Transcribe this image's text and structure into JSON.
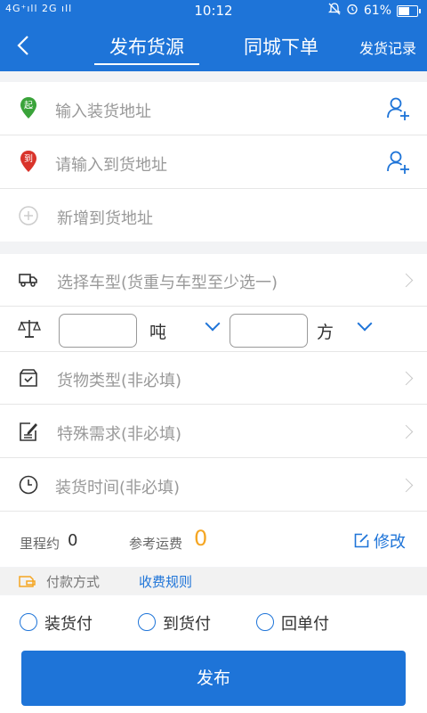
{
  "status": {
    "signal": "4G⁺ıll 2G ıll",
    "time": "10:12",
    "battery": "61%",
    "battery_level": 0.61
  },
  "nav": {
    "tab_publish": "发布货源",
    "tab_city": "同城下单",
    "records": "发货记录"
  },
  "address": {
    "load_placeholder": "输入装货地址",
    "load_badge": "起",
    "arrive_placeholder": "请输入到货地址",
    "arrive_badge": "到",
    "add_arrive": "新增到货地址"
  },
  "vehicle": {
    "select": "选择车型(货重与车型至少选一)"
  },
  "weight": {
    "unit_ton": "吨",
    "unit_cube": "方",
    "ton_value": "",
    "cube_value": ""
  },
  "goods": {
    "type": "货物类型(非必填)",
    "special": "特殊需求(非必填)",
    "time": "装货时间(非必填)"
  },
  "summary": {
    "mileage_label": "里程约",
    "mileage_value": "0",
    "fee_label": "参考运费",
    "fee_value": "0",
    "edit": "修改"
  },
  "payment": {
    "label": "付款方式",
    "rules": "收费规则",
    "options": [
      "装货付",
      "到货付",
      "回单付"
    ]
  },
  "publish_button": "发布",
  "colors": {
    "brand": "#1e74d8",
    "fee": "#f5a623",
    "start_pin": "#3aa33a",
    "end_pin": "#d9342b"
  }
}
